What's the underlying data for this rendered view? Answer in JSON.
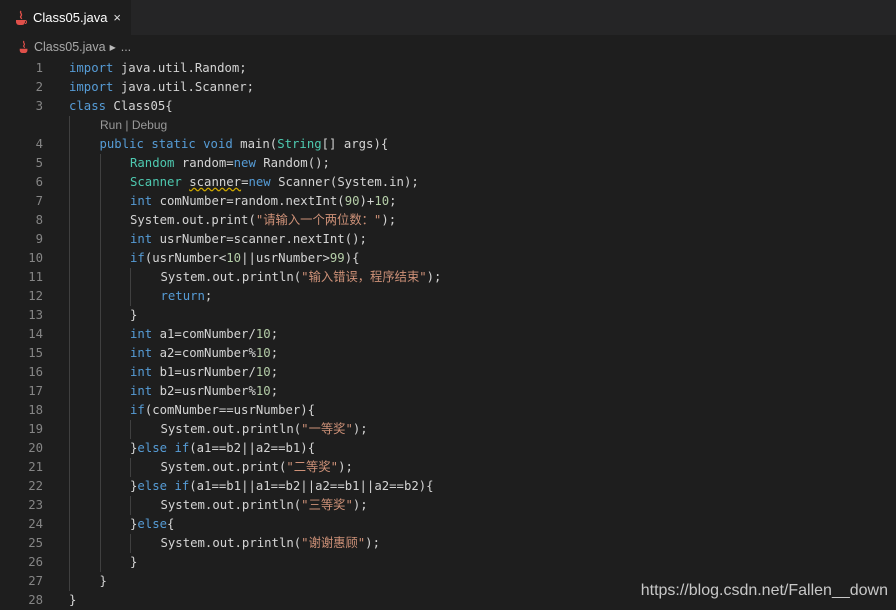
{
  "tab": {
    "label": "Class05.java",
    "close": "×",
    "icon": "java-icon"
  },
  "breadcrumb": {
    "file": "Class05.java",
    "ellipsis": "..."
  },
  "codelens": {
    "run": "Run",
    "sep": " | ",
    "debug": "Debug"
  },
  "lines": [
    {
      "n": "1",
      "indent": 0,
      "tokens": [
        [
          "kw",
          "import"
        ],
        [
          "",
          "java.util.Random;"
        ]
      ]
    },
    {
      "n": "2",
      "indent": 0,
      "tokens": [
        [
          "kw",
          "import"
        ],
        [
          "",
          "java.util.Scanner;"
        ]
      ]
    },
    {
      "n": "3",
      "indent": 0,
      "tokens": [
        [
          "kw",
          "class"
        ],
        [
          "",
          " Class05{"
        ]
      ]
    },
    {
      "n": "4",
      "indent": 1,
      "tokens": [
        [
          "kw",
          "public"
        ],
        [
          "",
          " "
        ],
        [
          "kw",
          "static"
        ],
        [
          "",
          " "
        ],
        [
          "kw",
          "void"
        ],
        [
          "",
          " main("
        ],
        [
          "ty",
          "String"
        ],
        [
          "",
          "[] args){"
        ]
      ]
    },
    {
      "n": "5",
      "indent": 2,
      "tokens": [
        [
          "ty",
          "Random"
        ],
        [
          "",
          " random="
        ],
        [
          "kw",
          "new"
        ],
        [
          "",
          " Random();"
        ]
      ]
    },
    {
      "n": "6",
      "indent": 2,
      "tokens": [
        [
          "ty",
          "Scanner"
        ],
        [
          "",
          " "
        ],
        [
          "wv",
          "scanner"
        ],
        [
          "",
          "="
        ],
        [
          "kw",
          "new"
        ],
        [
          "",
          " Scanner(System.in);"
        ]
      ]
    },
    {
      "n": "7",
      "indent": 2,
      "tokens": [
        [
          "kw",
          "int"
        ],
        [
          "",
          " comNumber=random.nextInt("
        ],
        [
          "nm",
          "90"
        ],
        [
          "",
          ")+"
        ],
        [
          "nm",
          "10"
        ],
        [
          "",
          ";"
        ]
      ]
    },
    {
      "n": "8",
      "indent": 2,
      "tokens": [
        [
          "",
          "System.out.print("
        ],
        [
          "st",
          "\"请输入一个两位数：\""
        ],
        [
          "",
          ");"
        ]
      ]
    },
    {
      "n": "9",
      "indent": 2,
      "tokens": [
        [
          "kw",
          "int"
        ],
        [
          "",
          " usrNumber=scanner.nextInt();"
        ]
      ]
    },
    {
      "n": "10",
      "indent": 2,
      "tokens": [
        [
          "kw",
          "if"
        ],
        [
          "",
          "(usrNumber<"
        ],
        [
          "nm",
          "10"
        ],
        [
          "",
          "||usrNumber>"
        ],
        [
          "nm",
          "99"
        ],
        [
          "",
          "){"
        ]
      ]
    },
    {
      "n": "11",
      "indent": 3,
      "tokens": [
        [
          "",
          "System.out.println("
        ],
        [
          "st",
          "\"输入错误，程序结束\""
        ],
        [
          "",
          ");"
        ]
      ]
    },
    {
      "n": "12",
      "indent": 3,
      "tokens": [
        [
          "kw",
          "return"
        ],
        [
          "",
          ";"
        ]
      ]
    },
    {
      "n": "13",
      "indent": 2,
      "tokens": [
        [
          "",
          "}"
        ]
      ]
    },
    {
      "n": "14",
      "indent": 2,
      "tokens": [
        [
          "kw",
          "int"
        ],
        [
          "",
          " a1=comNumber/"
        ],
        [
          "nm",
          "10"
        ],
        [
          "",
          ";"
        ]
      ]
    },
    {
      "n": "15",
      "indent": 2,
      "tokens": [
        [
          "kw",
          "int"
        ],
        [
          "",
          " a2=comNumber%"
        ],
        [
          "nm",
          "10"
        ],
        [
          "",
          ";"
        ]
      ]
    },
    {
      "n": "16",
      "indent": 2,
      "tokens": [
        [
          "kw",
          "int"
        ],
        [
          "",
          " b1=usrNumber/"
        ],
        [
          "nm",
          "10"
        ],
        [
          "",
          ";"
        ]
      ]
    },
    {
      "n": "17",
      "indent": 2,
      "tokens": [
        [
          "kw",
          "int"
        ],
        [
          "",
          " b2=usrNumber%"
        ],
        [
          "nm",
          "10"
        ],
        [
          "",
          ";"
        ]
      ]
    },
    {
      "n": "18",
      "indent": 2,
      "tokens": [
        [
          "kw",
          "if"
        ],
        [
          "",
          "(comNumber==usrNumber){"
        ]
      ]
    },
    {
      "n": "19",
      "indent": 3,
      "tokens": [
        [
          "",
          "System.out.println("
        ],
        [
          "st",
          "\"一等奖\""
        ],
        [
          "",
          ");"
        ]
      ]
    },
    {
      "n": "20",
      "indent": 2,
      "tokens": [
        [
          "",
          "}"
        ],
        [
          "kw",
          "else"
        ],
        [
          "",
          " "
        ],
        [
          "kw",
          "if"
        ],
        [
          "",
          "(a1==b2||a2==b1){"
        ]
      ]
    },
    {
      "n": "21",
      "indent": 3,
      "tokens": [
        [
          "",
          "System.out.print("
        ],
        [
          "st",
          "\"二等奖\""
        ],
        [
          "",
          ");"
        ]
      ]
    },
    {
      "n": "22",
      "indent": 2,
      "tokens": [
        [
          "",
          "}"
        ],
        [
          "kw",
          "else"
        ],
        [
          "",
          " "
        ],
        [
          "kw",
          "if"
        ],
        [
          "",
          "(a1==b1||a1==b2||a2==b1||a2==b2){"
        ]
      ]
    },
    {
      "n": "23",
      "indent": 3,
      "tokens": [
        [
          "",
          "System.out.println("
        ],
        [
          "st",
          "\"三等奖\""
        ],
        [
          "",
          ");"
        ]
      ]
    },
    {
      "n": "24",
      "indent": 2,
      "tokens": [
        [
          "",
          "}"
        ],
        [
          "kw",
          "else"
        ],
        [
          "",
          "{"
        ]
      ]
    },
    {
      "n": "25",
      "indent": 3,
      "tokens": [
        [
          "",
          "System.out.println("
        ],
        [
          "st",
          "\"谢谢惠顾\""
        ],
        [
          "",
          ");"
        ]
      ]
    },
    {
      "n": "26",
      "indent": 2,
      "tokens": [
        [
          "",
          "}"
        ]
      ]
    },
    {
      "n": "27",
      "indent": 1,
      "tokens": [
        [
          "",
          "}"
        ]
      ]
    },
    {
      "n": "28",
      "indent": 0,
      "tokens": [
        [
          "",
          "}"
        ]
      ]
    }
  ],
  "watermark": "https://blog.csdn.net/Fallen__down"
}
